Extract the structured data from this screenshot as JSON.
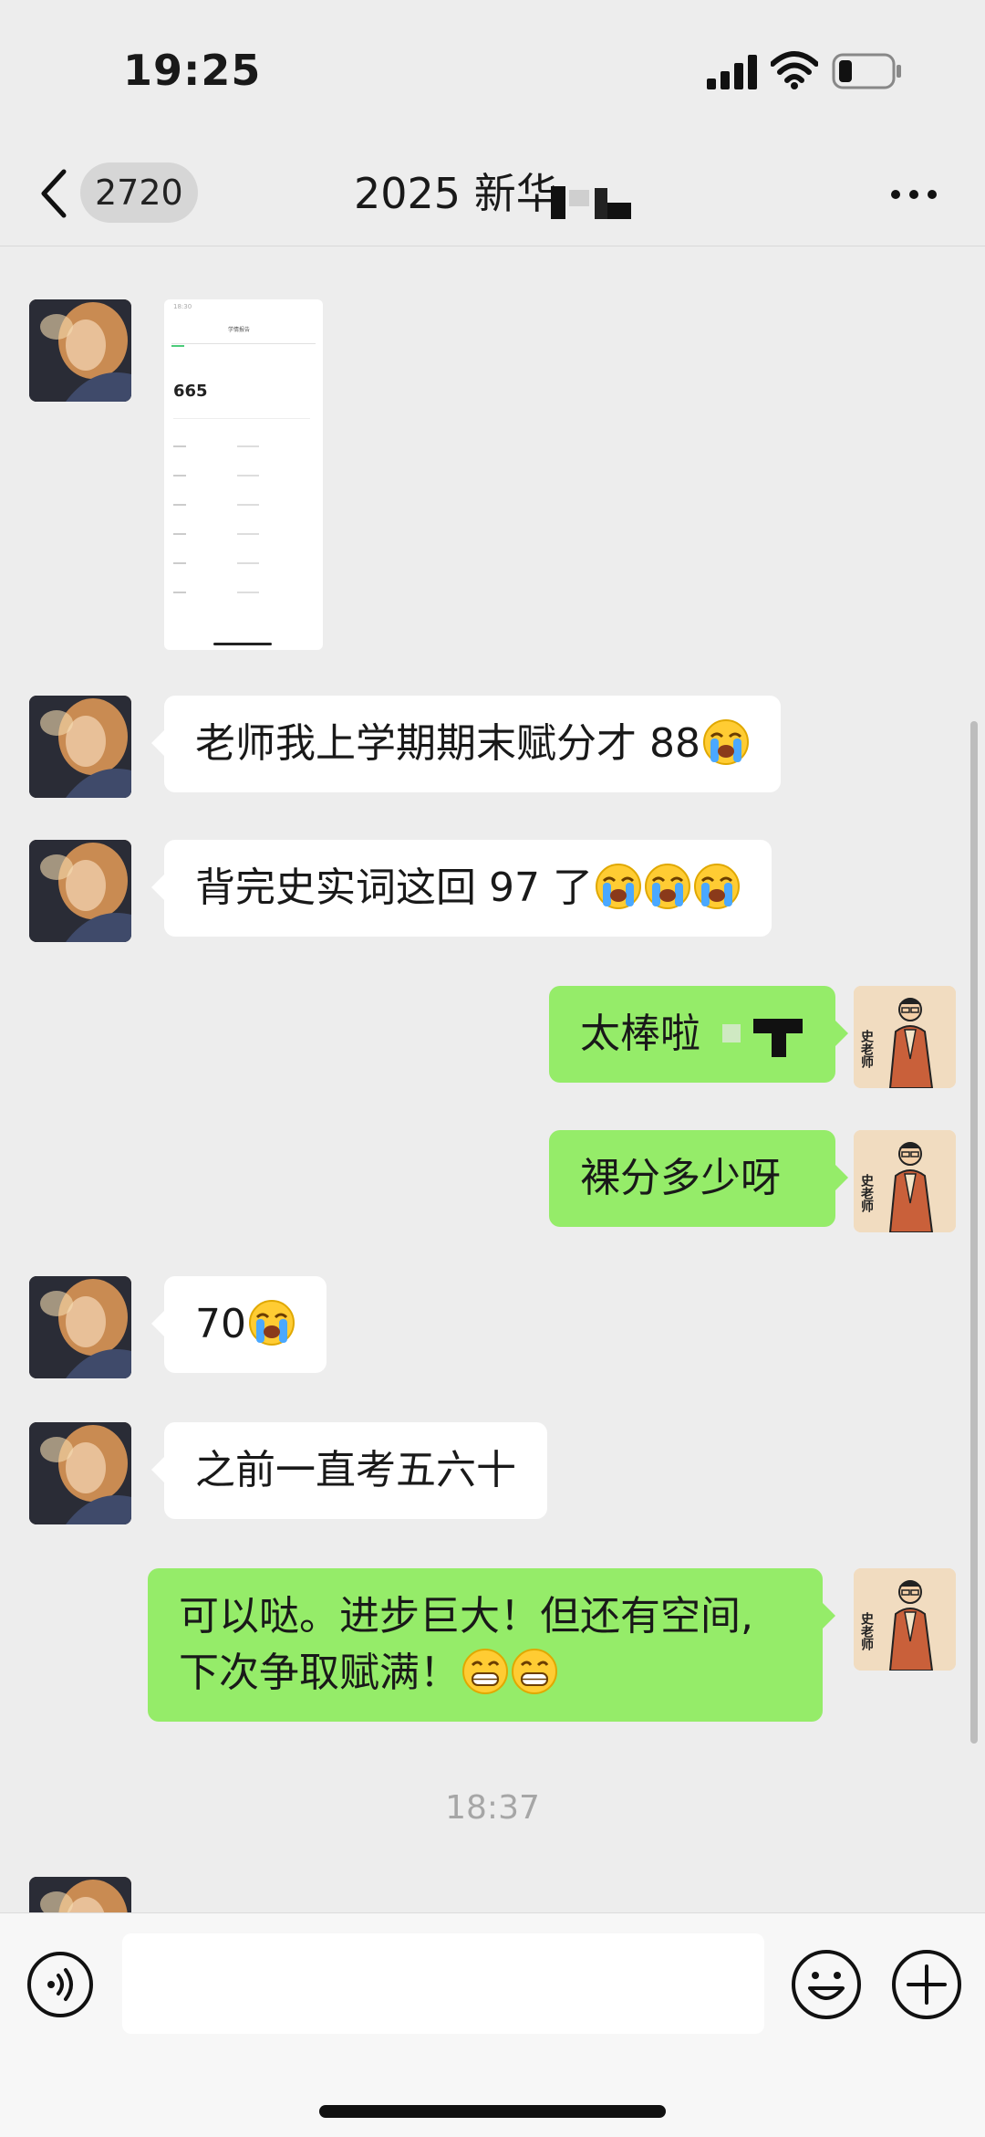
{
  "status_bar": {
    "time": "19:25"
  },
  "nav": {
    "unread_count": "2720",
    "title": "2025 新华"
  },
  "messages": [
    {
      "side": "left",
      "type": "image",
      "image": {
        "header_time": "18:30",
        "header_title": "学情报告",
        "score": "665"
      }
    },
    {
      "side": "left",
      "type": "text",
      "text": "老师我上学期期末赋分才 88",
      "emojis": [
        "crying-emoji"
      ]
    },
    {
      "side": "left",
      "type": "text",
      "text": "背完史实词这回 97 了",
      "emojis": [
        "crying-emoji",
        "crying-emoji",
        "crying-emoji"
      ]
    },
    {
      "side": "right",
      "type": "text",
      "text": "太棒啦"
    },
    {
      "side": "right",
      "type": "text",
      "text": "裸分多少呀"
    },
    {
      "side": "left",
      "type": "text",
      "text": "70",
      "emojis": [
        "crying-emoji"
      ]
    },
    {
      "side": "left",
      "type": "text",
      "text": "之前一直考五六十"
    },
    {
      "side": "right",
      "type": "text",
      "text_line1": "可以哒。进步巨大！但还有空间,",
      "text_line2": "下次争取赋满！",
      "emojis": [
        "grinning-emoji",
        "grinning-emoji"
      ]
    }
  ],
  "timestamp": "18:37",
  "colors": {
    "background": "#ededed",
    "bubble_sent": "#95ec69",
    "bubble_received": "#ffffff"
  },
  "icons": [
    "back-icon",
    "more-icon",
    "voice-icon",
    "emoji-icon",
    "plus-icon",
    "signal-icon",
    "wifi-icon",
    "battery-icon"
  ]
}
